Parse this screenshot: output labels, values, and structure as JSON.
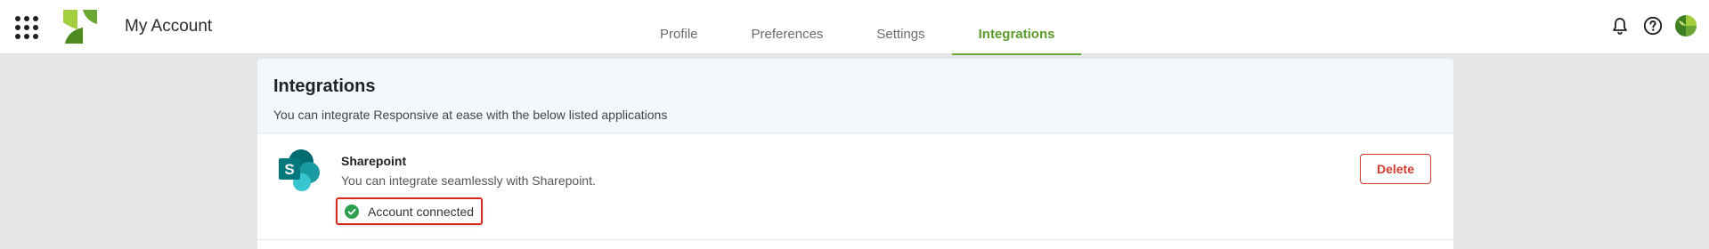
{
  "header": {
    "title": "My Account",
    "apps_icon": "grid-dots-icon",
    "logo_icon": "brand-leaf-logo",
    "tabs": [
      {
        "label": "Profile",
        "active": false
      },
      {
        "label": "Preferences",
        "active": false
      },
      {
        "label": "Settings",
        "active": false
      },
      {
        "label": "Integrations",
        "active": true
      }
    ],
    "icons": [
      "bell-icon",
      "help-icon",
      "avatar"
    ]
  },
  "colors": {
    "accent": "#6aa833",
    "danger": "#d23a30",
    "success": "#2e9e4f",
    "panel_bg": "#f3f8fc",
    "page_bg": "#e5e6e8"
  },
  "integrations_panel": {
    "title": "Integrations",
    "subtitle": "You can integrate Responsive at ease with the below listed applications",
    "items": [
      {
        "name": "Sharepoint",
        "description": "You can integrate seamlessly with Sharepoint.",
        "status": "Account connected",
        "status_icon": "check-circle-icon",
        "logo_icon": "sharepoint-logo",
        "action_label": "Delete"
      }
    ]
  }
}
